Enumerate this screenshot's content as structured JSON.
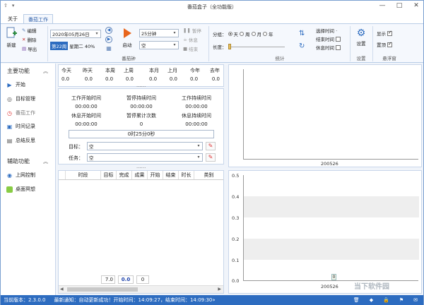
{
  "window": {
    "title": "番茄盒子（全功能版）",
    "minimize": "—",
    "maximize": "□",
    "close": "✕"
  },
  "quick_access": [
    "⇧",
    "▾"
  ],
  "tabs": [
    "关于",
    "番茄工作"
  ],
  "ribbon": {
    "new_label": "新建",
    "edit_label": "编辑",
    "delete_label": "删除",
    "export_label": "导出",
    "date_value": "2020年05月26日",
    "week_badge": "第22周",
    "weekday_text": "星期二 40%",
    "start_label": "启动",
    "duration_value": "25分钟",
    "mode_value": "空",
    "pause_label": "暂停",
    "rest_label": "休息",
    "end_label": "结束",
    "group_tomato": "番茄钟",
    "group_by_label": "分组：",
    "group_options": [
      "天",
      "周",
      "月",
      "年"
    ],
    "length_label": "长度：",
    "group_stats": "统计",
    "select_time_label": "选择时间 ·",
    "end_time_label": "结束时间",
    "rest_time_label": "休息时间",
    "settings_label": "设置",
    "group_settings": "设置",
    "show_label": "显示",
    "pin_label": "置顶",
    "group_float": "悬浮窗"
  },
  "sidebar": {
    "main_head": "主要功能",
    "main_items": [
      "开始",
      "目标管理",
      "番茄工作",
      "时间记录",
      "总结反思"
    ],
    "aux_head": "辅助功能",
    "aux_items": [
      "上网控制",
      "桌面冥想"
    ]
  },
  "stats": [
    {
      "a_label": "今天",
      "b_label": "昨天",
      "a_val": "0.0",
      "b_val": "0.0"
    },
    {
      "a_label": "本周",
      "b_label": "上周",
      "a_val": "0.0",
      "b_val": "0.0"
    },
    {
      "a_label": "本月",
      "b_label": "上月",
      "a_val": "0.0",
      "b_val": "0.0"
    },
    {
      "a_label": "今年",
      "b_label": "去年",
      "a_val": "0.0",
      "b_val": "0.0"
    }
  ],
  "pager": "......",
  "timers": [
    {
      "label": "工作开始时间",
      "value": "00:00:00"
    },
    {
      "label": "暂停持续时间",
      "value": "00:00:00"
    },
    {
      "label": "工作持续时间",
      "value": "00:00:00"
    },
    {
      "label": "休息开始时间",
      "value": "00:00:00"
    },
    {
      "label": "暂停累计次数",
      "value": "0"
    },
    {
      "label": "休息持续时间",
      "value": "00:00:00"
    }
  ],
  "progress_text": "0时25分0秒",
  "goal_label": "目标：",
  "goal_value": "空",
  "task_label": "任务：",
  "task_value": "空",
  "pager2": "......",
  "table": {
    "columns": [
      "时段",
      "目标",
      "完成",
      "成果",
      "开始",
      "结束",
      "时长",
      "类别"
    ],
    "footer": [
      "7.0",
      "0.0",
      "0"
    ]
  },
  "chart_top": {
    "xlabel": "200526"
  },
  "chart_bottom": {
    "ticks": [
      "0.5",
      "0.4",
      "0.3",
      "0.2",
      "0.1",
      "0.0"
    ],
    "xlabel": "200526",
    "bar_label": "0"
  },
  "statusbar": {
    "version_label": "当前版本：",
    "version": "2.3.0.0",
    "notice_label": "最新通知：",
    "notice": "自动更新成功！开始时间：14:09:27，结束时间：14:09:30»"
  },
  "watermark": "当下软件园"
}
